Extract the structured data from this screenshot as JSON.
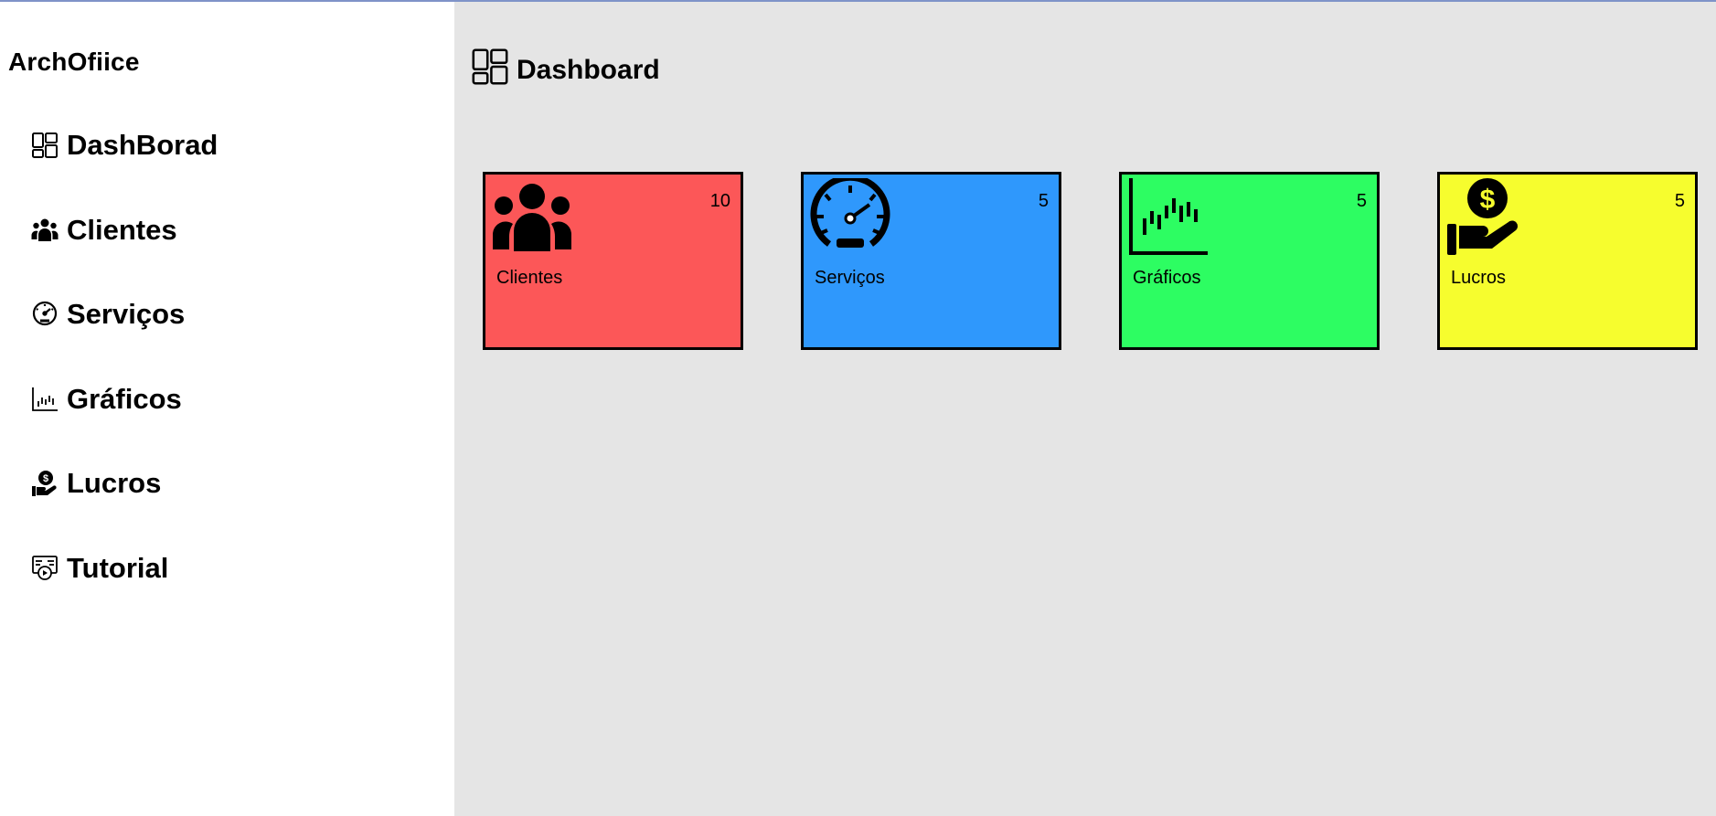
{
  "sidebar": {
    "brand": "ArchOfiice",
    "items": [
      {
        "label": "DashBorad",
        "icon": "dashboard-icon"
      },
      {
        "label": "Clientes",
        "icon": "users-icon"
      },
      {
        "label": "Serviços",
        "icon": "gauge-icon"
      },
      {
        "label": "Gráficos",
        "icon": "chart-icon"
      },
      {
        "label": "Lucros",
        "icon": "money-hand-icon"
      },
      {
        "label": "Tutorial",
        "icon": "tutorial-icon"
      }
    ]
  },
  "main": {
    "title": "Dashboard",
    "title_icon": "dashboard-icon",
    "cards": [
      {
        "label": "Clientes",
        "count": "10",
        "color": "#fc5758",
        "icon": "users-icon"
      },
      {
        "label": "Serviços",
        "count": "5",
        "color": "#2f98fc",
        "icon": "gauge-icon"
      },
      {
        "label": "Gráficos",
        "count": "5",
        "color": "#2dfd62",
        "icon": "chart-icon"
      },
      {
        "label": "Lucros",
        "count": "5",
        "color": "#f6fd2e",
        "icon": "money-hand-icon"
      }
    ]
  },
  "colors": {
    "sidebar_bg": "#ffffff",
    "main_bg": "#e5e5e5",
    "top_border": "#7f93c8"
  }
}
